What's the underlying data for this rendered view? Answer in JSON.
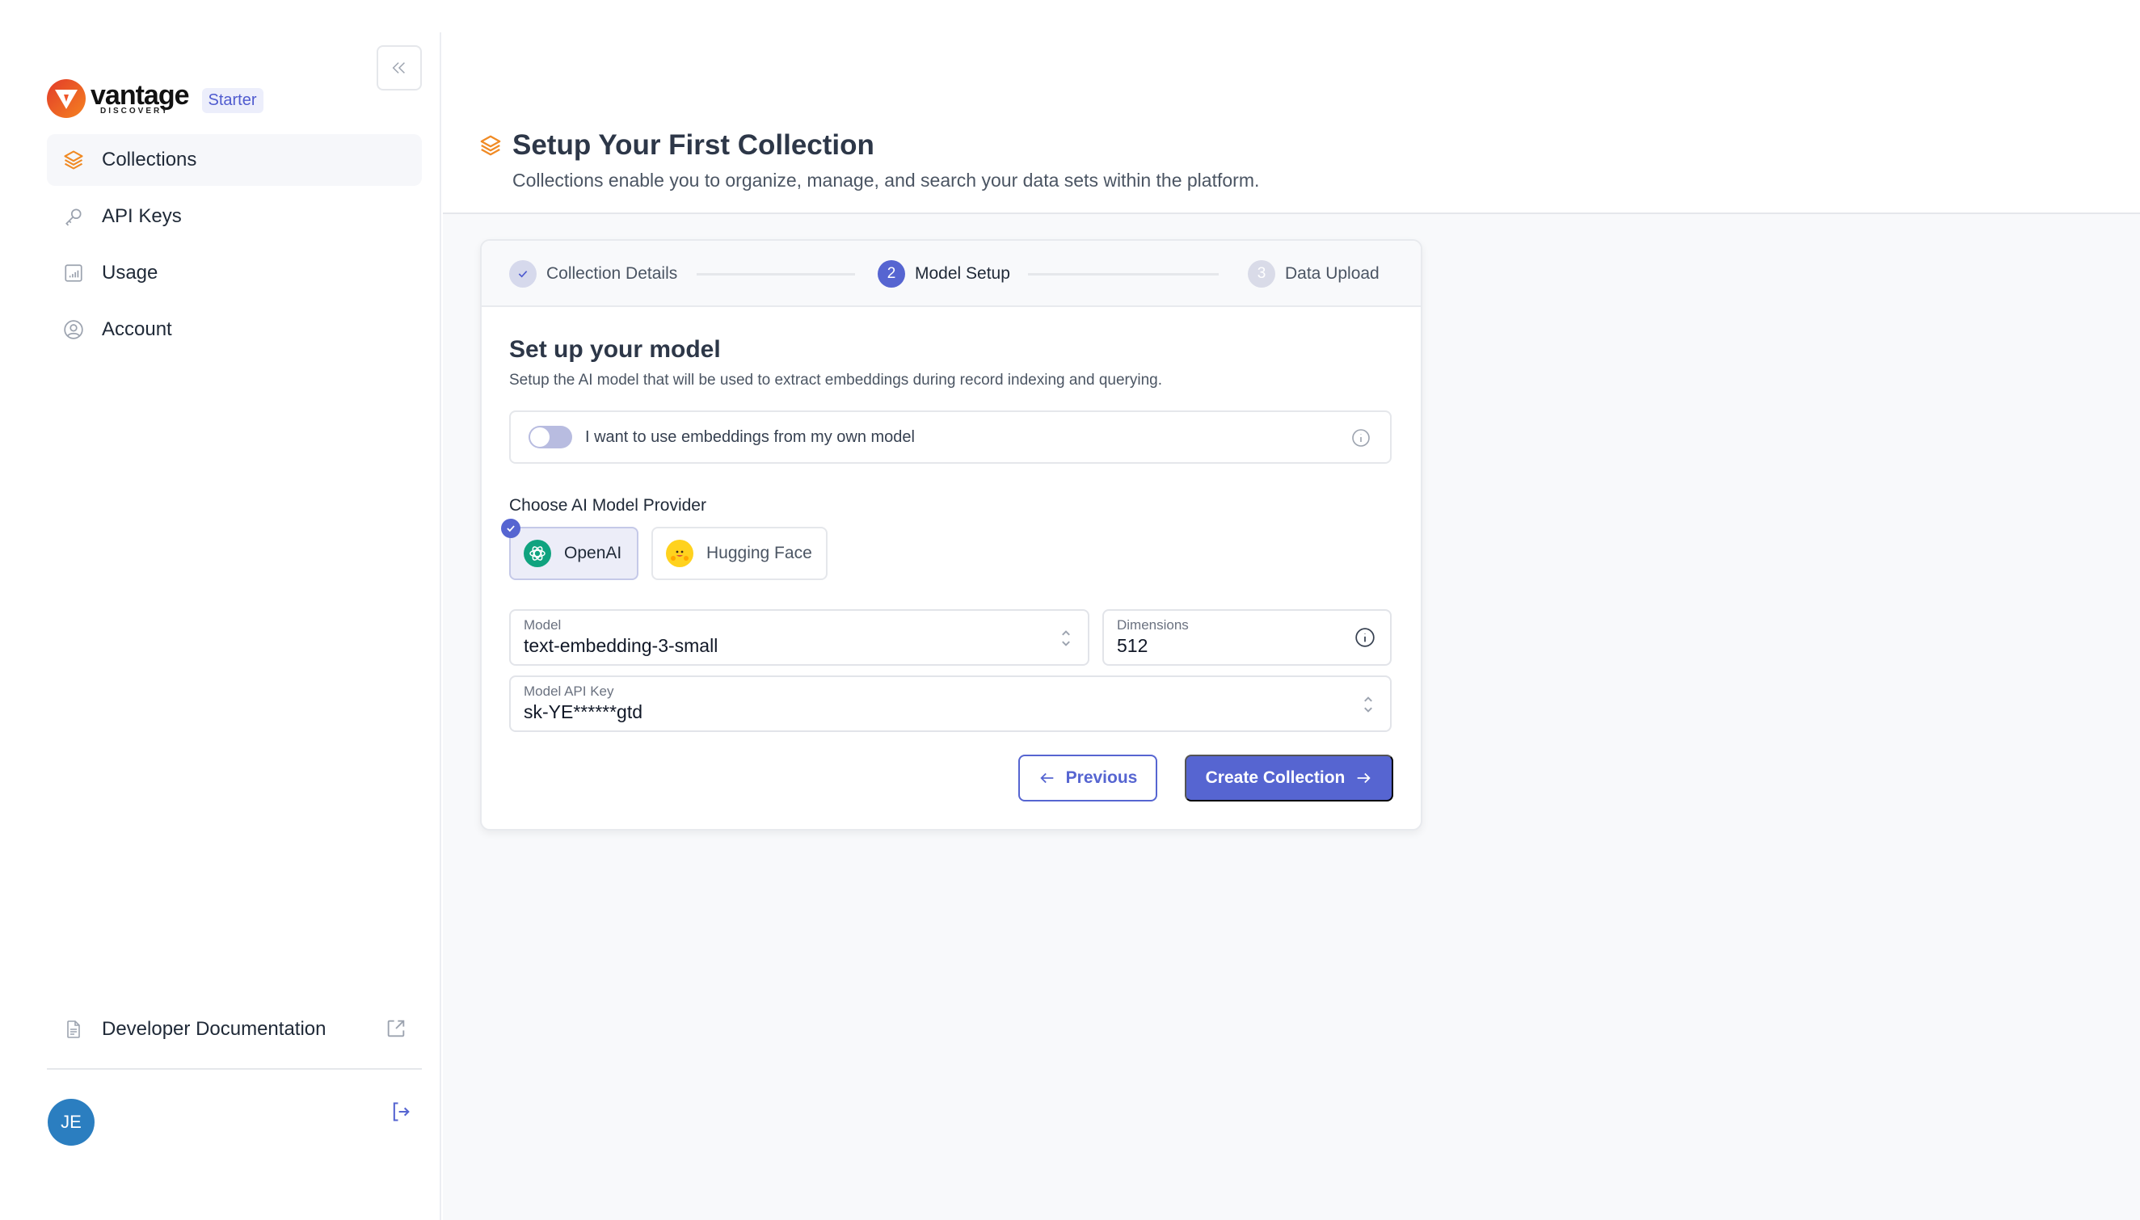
{
  "brand": {
    "name": "vantage",
    "sub": "DISCOVERY",
    "plan_badge": "Starter"
  },
  "sidebar": {
    "items": [
      {
        "label": "Collections",
        "icon": "layers-icon",
        "active": true
      },
      {
        "label": "API Keys",
        "icon": "key-icon",
        "active": false
      },
      {
        "label": "Usage",
        "icon": "bar-chart-icon",
        "active": false
      },
      {
        "label": "Account",
        "icon": "user-circle-icon",
        "active": false
      }
    ],
    "dev_docs_label": "Developer Documentation",
    "user_initials": "JE"
  },
  "header": {
    "title": "Setup Your First Collection",
    "subtitle": "Collections enable you to organize, manage, and search your data sets within the platform."
  },
  "stepper": {
    "steps": [
      {
        "number": "1",
        "label": "Collection Details",
        "status": "done"
      },
      {
        "number": "2",
        "label": "Model Setup",
        "status": "current"
      },
      {
        "number": "3",
        "label": "Data Upload",
        "status": "upcoming"
      }
    ]
  },
  "form": {
    "title": "Set up your model",
    "subtitle": "Setup the AI model that will be used to extract embeddings during record indexing and querying.",
    "own_model_toggle": {
      "label": "I want to use embeddings from my own model",
      "checked": false
    },
    "provider_label": "Choose AI Model Provider",
    "providers": [
      {
        "label": "OpenAI",
        "selected": true
      },
      {
        "label": "Hugging Face",
        "selected": false
      }
    ],
    "model": {
      "label": "Model",
      "value": "text-embedding-3-small"
    },
    "dimensions": {
      "label": "Dimensions",
      "value": "512"
    },
    "api_key": {
      "label": "Model API Key",
      "value": "sk-YE******gtd"
    },
    "previous_label": "Previous",
    "create_label": "Create Collection"
  },
  "colors": {
    "accent": "#5665d1",
    "brand_orange": "#f58220",
    "avatar": "#2b7ec0"
  }
}
